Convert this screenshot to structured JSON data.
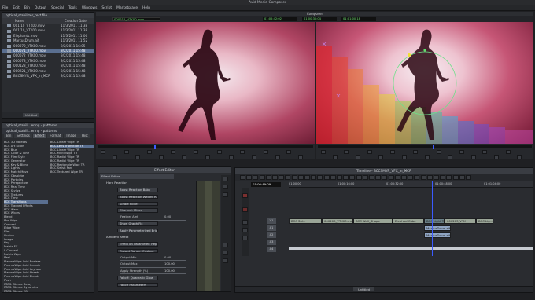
{
  "app": {
    "title": "Avid Media Composer"
  },
  "menu": [
    "File",
    "Edit",
    "Bin",
    "Output",
    "Special",
    "Tools",
    "Windows",
    "Script",
    "Marketplace",
    "Help"
  ],
  "bin": {
    "tab": "optical_stabilizer_test file",
    "col_name": "Name",
    "col_date": "Creation Date",
    "rows": [
      {
        "name": "001/10_VTK00.mov",
        "date": "11/3/2011 11:38"
      },
      {
        "name": "001/10_VTK00.mov",
        "date": "11/3/2011 11:38"
      },
      {
        "name": "Elephants.mov",
        "date": "11/3/2011 11:06"
      },
      {
        "name": "MarcusDrum.aif",
        "date": "11/3/2011 11:52"
      },
      {
        "name": "000070_VTK00.mov",
        "date": "9/2/2011 16:05"
      },
      {
        "name": "000071_VTK00.mov",
        "date": "9/2/2011 15:48"
      },
      {
        "name": "000072_VTK00.mov",
        "date": "9/2/2011 15:48"
      },
      {
        "name": "000073_VTK00.mov",
        "date": "9/2/2011 15:48"
      },
      {
        "name": "000123_VTK00.mov",
        "date": "9/2/2011 15:48"
      },
      {
        "name": "000221_VTK00.mov",
        "date": "9/2/2011 15:48"
      },
      {
        "name": "BCCSMYR_VFX_in_MCR",
        "date": "9/2/2011 15:48"
      }
    ],
    "footer": "Untitled"
  },
  "effects": {
    "tab": "optical_stabili...ering - patterns",
    "tabs": [
      "Bin",
      "Settings",
      "Effect",
      "Format",
      "Image",
      "Hist"
    ],
    "categories": [
      "BCC 3D Objects",
      "BCC Art Looks",
      "BCC Blur",
      "BCC Color & Tone",
      "BCC Film Style",
      "BCC Generator",
      "BCC Key & Blend",
      "BCC Lights",
      "BCC Match Move",
      "BCC Obsolete",
      "BCC Particles",
      "BCC Perspective",
      "BCC Real Time",
      "BCC Stylize",
      "BCC Textures",
      "BCC Time",
      "BCC Transitions",
      "BCC Tracked Effects",
      "BCC Warp",
      "BCC Wipes",
      "Blend",
      "Box Wipe",
      "Conceal",
      "Edge Wipe",
      "Film",
      "Illusion",
      "Image",
      "Key",
      "Matrix FX",
      "L-Conceal",
      "Matrix Wipe",
      "Peel",
      "PlasmaWipe Avid Boxless",
      "PlasmaWipe Avid Curtain",
      "PlasmaWipe Avid Keyhole",
      "PlasmaWipe Avid Sheets",
      "PlasmaWipe Avid Blends",
      "Push",
      "RTAS: Stereo Delay",
      "RTAS: Stereo Dynamics",
      "RTAS: Stereo EQ"
    ],
    "items": [
      "BCC Linear Wipe TR",
      "BCC Lens Transition TR",
      "BCC Linear Wipe TR",
      "BCC Multi Wipe TR",
      "BCC Radial Wipe TR",
      "BCC Radial Wipe TR",
      "BCC Rectangle Wipe TR",
      "BCC Swish Pan",
      "BCC Textured Wipe TR"
    ]
  },
  "composer": {
    "label": "Composer",
    "source_clip": "000211_VTK00.mov",
    "tc_left": "01:02:42:02",
    "tc_mid": "01:00:30:04",
    "tc_right": "01:01:00:18"
  },
  "effect_editor": {
    "title": "Effect Editor",
    "params": [
      {
        "label": "Hard Reaction",
        "value": ""
      },
      {
        "label": "Boost Reaction Baby",
        "value": ""
      },
      {
        "label": "Boost Reaction Weight Range",
        "value": ""
      },
      {
        "label": "Single Picker",
        "value": ""
      },
      {
        "label": "Channel: Mixed",
        "value": ""
      },
      {
        "label": "Feather Amt",
        "value": "0.00"
      },
      {
        "label": "Show Graph Fix",
        "value": ""
      },
      {
        "label": "Apply Parameterized Brightness",
        "value": ""
      },
      {
        "label": "Ambient Affect",
        "value": ""
      },
      {
        "label": "Effect on Parameter: Replace Value",
        "value": ""
      },
      {
        "label": "Output Range: Custom",
        "value": ""
      },
      {
        "label": "Output Min",
        "value": "0.00"
      },
      {
        "label": "Output Max",
        "value": "100.00"
      },
      {
        "label": "Apply Strength (%)",
        "value": "100.00"
      },
      {
        "label": "Falloff: Quadratic Glow",
        "value": ""
      },
      {
        "label": "Falloff Parameters",
        "value": ""
      }
    ]
  },
  "timeline": {
    "title": "Timeline - BCCSMYR_VFX_in_MCR",
    "timecode": "01:00:49:09",
    "ruler": [
      "01:00:00",
      "01:00:16:00",
      "01:00:32:00",
      "01:00:48:00",
      "01:01:04:00"
    ],
    "tracks": [
      "V1",
      "A1",
      "A2",
      "A3",
      "A4",
      "TC1"
    ],
    "v1_clips": [
      "BCC Sol...",
      "000200_VTK00.mov",
      "BCC Wall_Shape",
      "ElephantCube",
      "BCC Light Tran Blur TR",
      "000203_VTK",
      "BCC Lig..."
    ],
    "audio_clip": "MarcusDrum.aif",
    "footer": "Untitled"
  },
  "colors": {
    "accent": "#5a6f90",
    "clip": "#9aa597",
    "audio": "#8fa4c2",
    "playhead": "#3b5bff"
  }
}
